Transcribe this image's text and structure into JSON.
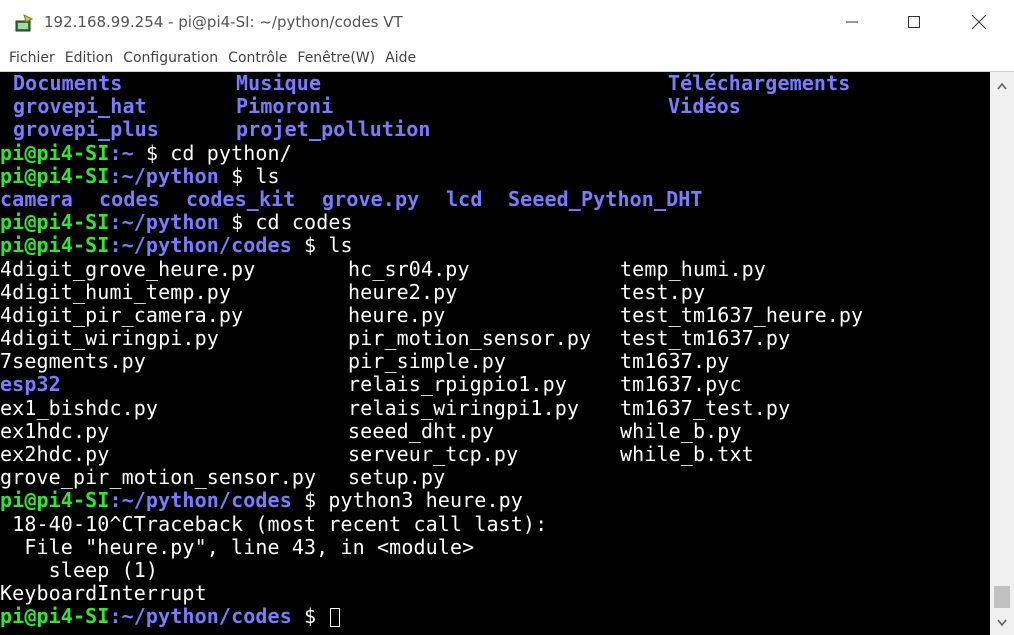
{
  "window": {
    "title": "192.168.99.254 - pi@pi4-SI: ~/python/codes VT",
    "icon": "putty-terminal-icon"
  },
  "menu": [
    "Fichier",
    "Edition",
    "Configuration",
    "Contrôle",
    "Fenêtre(W)",
    "Aide"
  ],
  "colors": {
    "terminal_bg": "#000000",
    "prompt_user": "#2ee82e",
    "directory": "#7b7bff",
    "text": "#ffffff"
  },
  "terminal": {
    "dir_listing_top": [
      [
        "Documents",
        "Musique",
        "Téléchargements"
      ],
      [
        "grovepi_hat",
        "Pimoroni",
        "Vidéos"
      ],
      [
        "grovepi_plus",
        "projet_pollution",
        ""
      ]
    ],
    "prompt_user": "pi@pi4-SI",
    "cmd1": {
      "path": ":~",
      "rest": " $ cd python/"
    },
    "cmd2": {
      "path": ":~/python",
      "rest": " $ ls"
    },
    "python_ls": [
      "camera",
      "codes",
      "codes_kit",
      "grove.py",
      "lcd",
      "Seeed_Python_DHT"
    ],
    "cmd3": {
      "path": ":~/python",
      "rest": " $ cd codes"
    },
    "cmd4": {
      "path": ":~/python/codes",
      "rest": " $ ls"
    },
    "files_col1": [
      "4digit_grove_heure.py",
      "4digit_humi_temp.py",
      "4digit_pir_camera.py",
      "4digit_wiringpi.py",
      "7segments.py",
      "esp32",
      "ex1_bishdc.py",
      "ex1hdc.py",
      "ex2hdc.py",
      "grove_pir_motion_sensor.py"
    ],
    "files_col2": [
      "hc_sr04.py",
      "heure2.py",
      "heure.py",
      "pir_motion_sensor.py",
      "pir_simple.py",
      "relais_rpigpio1.py",
      "relais_wiringpi1.py",
      "seeed_dht.py",
      "serveur_tcp.py",
      "setup.py"
    ],
    "files_col3": [
      "temp_humi.py",
      "test.py",
      "test_tm1637_heure.py",
      "test_tm1637.py",
      "tm1637.py",
      "tm1637.pyc",
      "tm1637_test.py",
      "while_b.py",
      "while_b.txt",
      ""
    ],
    "cmd5": {
      "path": ":~/python/codes",
      "rest": " $ python3 heure.py"
    },
    "output": [
      " 18-40-10^CTraceback (most recent call last):",
      "  File \"heure.py\", line 43, in <module>",
      "    sleep (1)",
      "KeyboardInterrupt"
    ],
    "cmd6": {
      "path": ":~/python/codes",
      "rest": " $ "
    }
  }
}
